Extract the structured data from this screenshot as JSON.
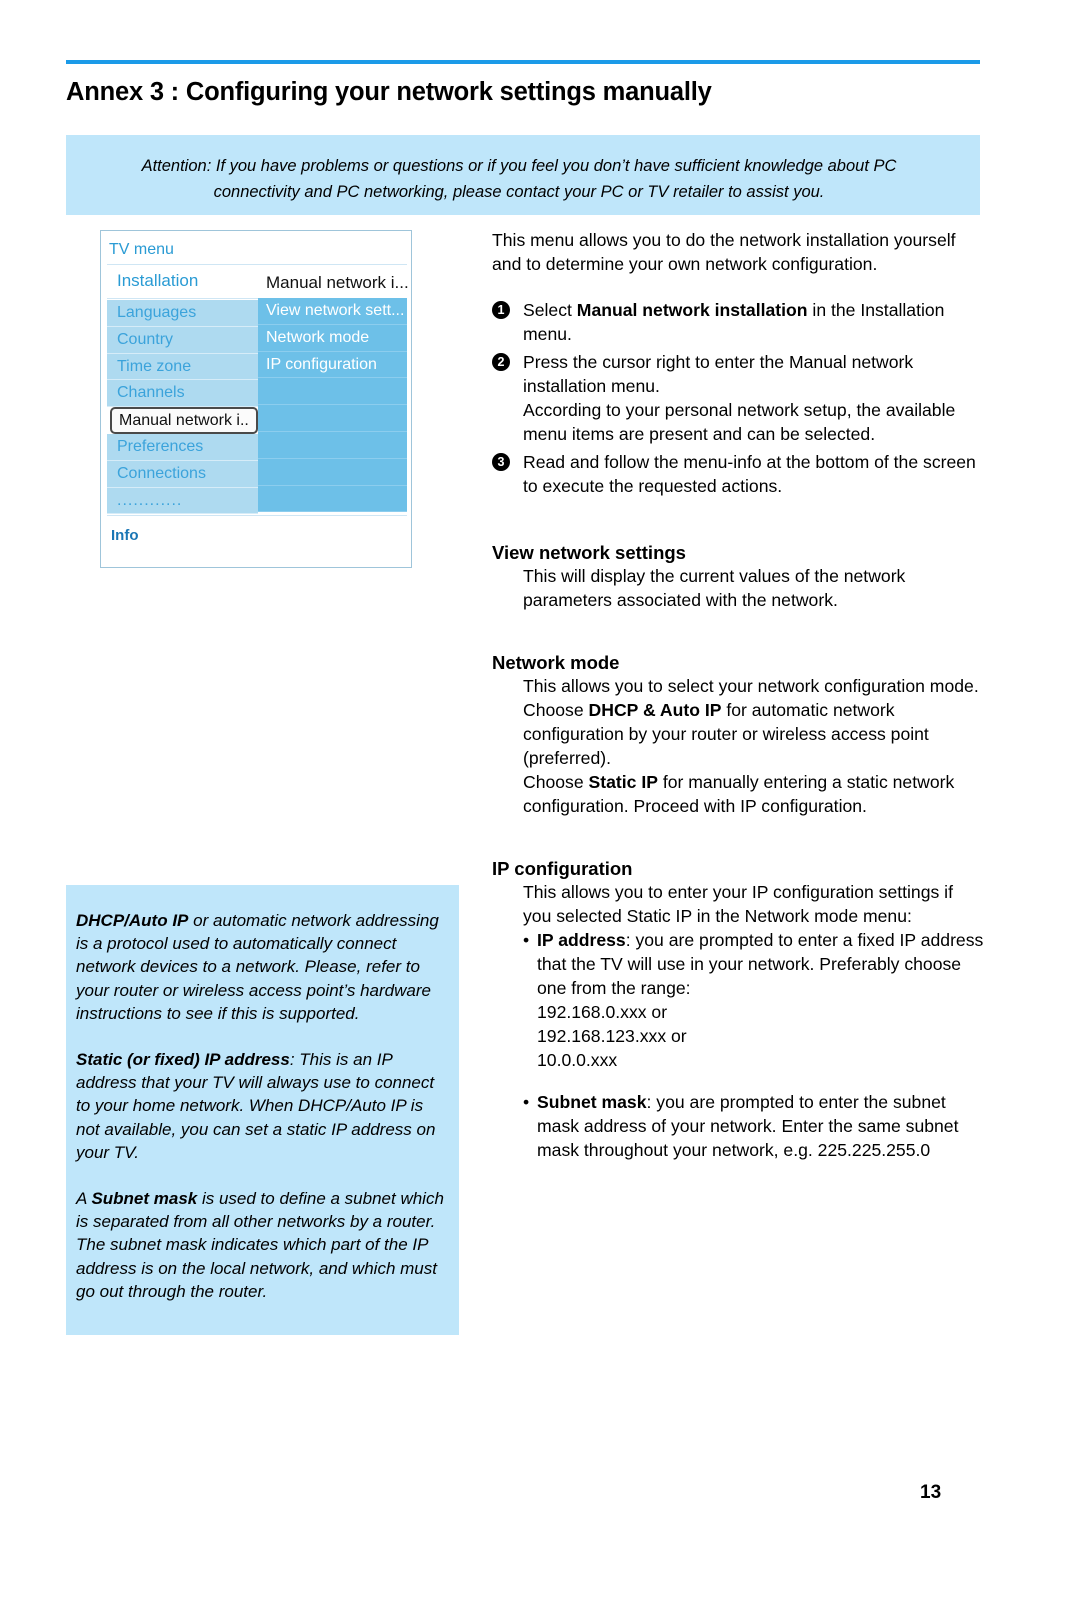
{
  "page": {
    "title": "Annex 3 : Configuring your network settings manually",
    "number": "13",
    "accent_color": "#1b9ae8",
    "banner_bg": "#bfe6fa"
  },
  "attention": {
    "line1": "Attention: If you have problems or questions or if you feel you don’t have sufficient knowledge about PC",
    "line2": "connectivity and PC networking, please contact your PC or TV retailer to assist you."
  },
  "tv_menu": {
    "title": "TV menu",
    "breadcrumb": "Installation",
    "info_label": "Info",
    "left_items": [
      {
        "label": "Languages",
        "selected": false
      },
      {
        "label": "Country",
        "selected": false
      },
      {
        "label": "Time zone",
        "selected": false
      },
      {
        "label": "Channels",
        "selected": false
      },
      {
        "label": "Manual network i..",
        "selected": true
      },
      {
        "label": "Preferences",
        "selected": false
      },
      {
        "label": "Connections",
        "selected": false
      },
      {
        "label": "............",
        "selected": false
      }
    ],
    "right_header": "Manual network i...",
    "right_items": [
      "View network sett...",
      "Network mode",
      "IP configuration"
    ]
  },
  "main": {
    "intro": "This menu allows you to do the network installation yourself and to determine your own network configuration.",
    "steps": [
      {
        "num": "1",
        "pre": "Select ",
        "bold": "Manual network installation",
        "post": " in the Installation menu."
      },
      {
        "num": "2",
        "pre": "Press the cursor right to enter the Manual network installation menu.",
        "bold": "",
        "post": "",
        "extra": "According to your personal network setup, the available menu items are present and can be selected."
      },
      {
        "num": "3",
        "pre": "Read and follow the menu-info at the bottom of the screen to execute the requested actions.",
        "bold": "",
        "post": ""
      }
    ],
    "sections": [
      {
        "heading": "View network settings",
        "body": "This will display the current values of the network parameters associated with the network."
      },
      {
        "heading": "Network mode",
        "p1": "This allows you to select your network configuration mode.",
        "p2_pre": "Choose ",
        "p2_bold": "DHCP & Auto IP",
        "p2_post": " for automatic network configuration by your router or wireless access point (preferred).",
        "p3_pre": "Choose ",
        "p3_bold": "Static IP",
        "p3_post": " for manually entering a static network configuration. Proceed with IP configuration."
      },
      {
        "heading": "IP configuration",
        "intro": "This allows you to enter your IP configuration settings if you selected Static IP in the Network mode menu:",
        "bullets": [
          {
            "bold": "IP address",
            "text": ": you are prompted to enter a fixed IP address that the TV will use in your network. Preferably choose one from the range:",
            "lines": [
              "192.168.0.xxx or",
              "192.168.123.xxx or",
              "10.0.0.xxx"
            ]
          },
          {
            "bold": "Subnet mask",
            "text": ": you are prompted to enter the subnet mask address of your network. Enter the same subnet mask throughout your network, e.g. 225.225.255.0",
            "lines": []
          }
        ]
      }
    ]
  },
  "info_box": {
    "p1_bold": "DHCP/Auto IP",
    "p1_text": " or automatic network addressing is a protocol used to automatically connect network devices to a network. Please, refer to your router or wireless access point’s hardware instructions to see if this is supported.",
    "p2_bold": "Static (or fixed) IP address",
    "p2_text": ": This is an IP address that your TV will always use to connect to your home network. When DHCP/Auto IP is not available, you can set a static IP address on your TV.",
    "p3_pre": "A ",
    "p3_bold": "Subnet mask",
    "p3_text": " is used to define a subnet which is separated from all other networks by a router. The subnet mask indicates which part of the IP address is on the local network, and which must go out through the router."
  }
}
